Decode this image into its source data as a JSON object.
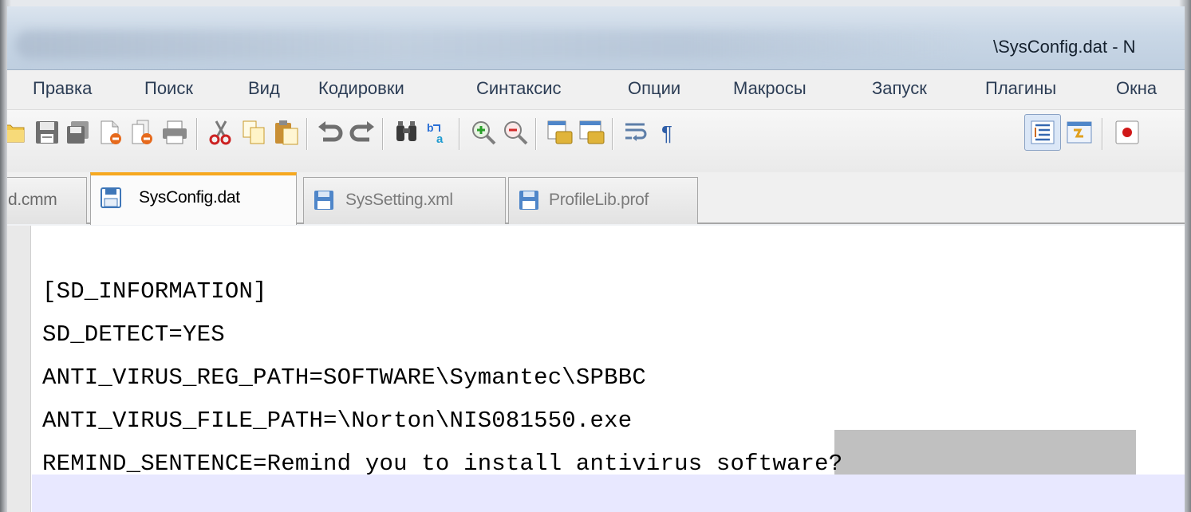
{
  "window": {
    "title": "\\SysConfig.dat - N"
  },
  "menu": {
    "items": [
      "Правка",
      "Поиск",
      "Вид",
      "Кодировки",
      "Синтаксис",
      "Опции",
      "Макросы",
      "Запуск",
      "Плагины",
      "Окна"
    ]
  },
  "toolbar": {
    "icons": [
      "open-icon",
      "save-icon",
      "save-all-icon",
      "close-icon",
      "close-all-icon",
      "print-icon",
      "cut-icon",
      "copy-icon",
      "paste-icon",
      "undo-icon",
      "redo-icon",
      "find-icon",
      "replace-icon",
      "zoom-in-icon",
      "zoom-out-icon",
      "sync-vertical-icon",
      "sync-horizontal-icon",
      "word-wrap-icon",
      "show-all-chars-icon",
      "indent-guide-icon",
      "doc-map-icon",
      "record-macro-icon"
    ]
  },
  "tabs": [
    {
      "label": "d.cmm",
      "active": false
    },
    {
      "label": "SysConfig.dat",
      "active": true
    },
    {
      "label": "SysSetting.xml",
      "active": false
    },
    {
      "label": "ProfileLib.prof",
      "active": false
    }
  ],
  "editor": {
    "lines": [
      "",
      "[SD_INFORMATION]",
      "SD_DETECT=YES",
      "ANTI_VIRUS_REG_PATH=SOFTWARE\\Symantec\\SPBBC",
      "ANTI_VIRUS_FILE_PATH=\\Norton\\NIS081550.exe",
      "REMIND_SENTENCE=Remind you to install antivirus software?"
    ],
    "selected_text": "virus software?"
  },
  "colors": {
    "accent_tab": "#f6a81f",
    "selection": "#c0c0c0",
    "current_line": "#e8e8ff",
    "menu_text": "#2c3d55"
  }
}
